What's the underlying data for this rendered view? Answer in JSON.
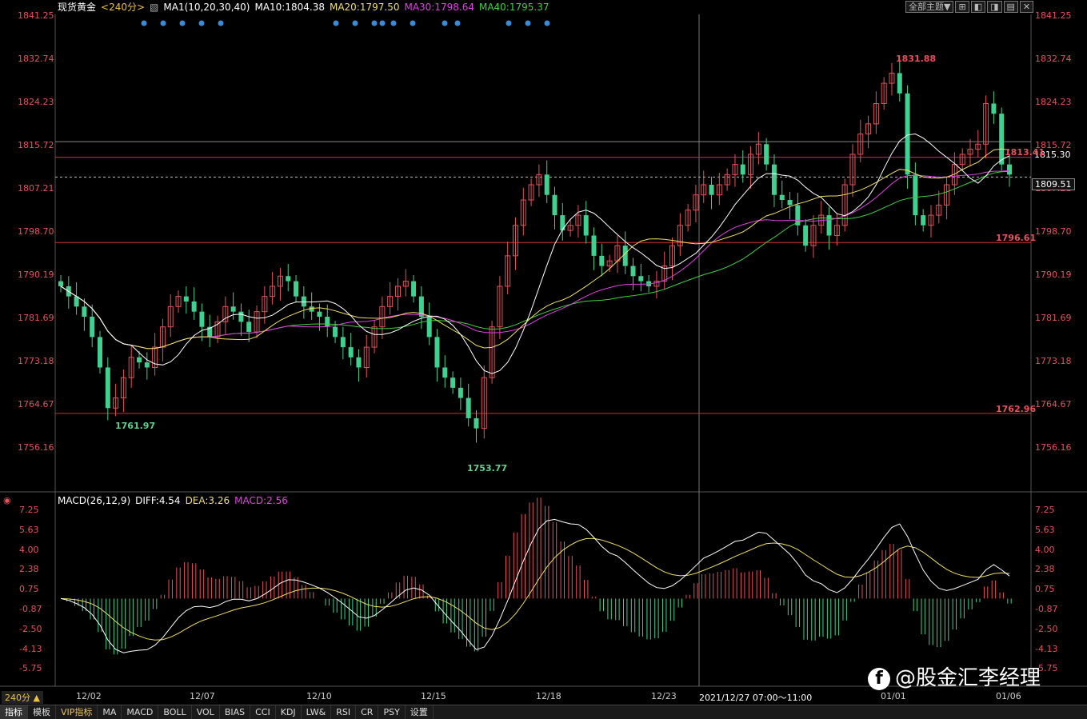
{
  "header": {
    "symbol": "现货黄金",
    "period": "<240分>",
    "ma_label": "MA1(10,20,30,40)",
    "ma10": "MA10:1804.38",
    "ma20": "MA20:1797.50",
    "ma30": "MA30:1798.64",
    "ma40": "MA40:1795.37",
    "theme_button": "全部主题▼",
    "colors": {
      "ma10": "#ffffff",
      "ma20": "#f0e060",
      "ma30": "#e040e0",
      "ma40": "#40d040"
    }
  },
  "price_axis": [
    "1841.25",
    "1832.74",
    "1824.23",
    "1815.72",
    "1807.21",
    "1798.70",
    "1790.19",
    "1781.69",
    "1773.18",
    "1764.67",
    "1756.16"
  ],
  "price_boxes": {
    "current_white": "1815.30",
    "current_box": "1809.51",
    "red_right": "1813.41"
  },
  "annotations": {
    "high": "1831.88",
    "low1": "1761.97",
    "low2": "1753.77",
    "line1": "1796.61",
    "line2": "1762.96"
  },
  "macd": {
    "label": "MACD(26,12,9)",
    "diff": "DIFF:4.54",
    "dea": "DEA:3.26",
    "macd": "MACD:2.56",
    "axis": [
      "7.25",
      "5.63",
      "4.00",
      "2.38",
      "0.75",
      "-0.87",
      "-2.50",
      "-4.13",
      "-5.75"
    ]
  },
  "dates": [
    "12/02",
    "12/07",
    "12/10",
    "12/15",
    "12/18",
    "12/23",
    "2021/12/27 07:00～11:00",
    "01/01",
    "01/06"
  ],
  "period_indicator": "240分 ▲",
  "bottom_tabs": [
    "指标",
    "模板",
    "VIP指标",
    "MA",
    "MACD",
    "BOLL",
    "VOL",
    "BIAS",
    "CCI",
    "KDJ",
    "LW&",
    "RSI",
    "CR",
    "PSY",
    "设置"
  ],
  "watermark": "@股金汇李经理",
  "chart_data": {
    "type": "candlestick",
    "title": "现货黄金",
    "ylim": [
      1750,
      1842
    ],
    "close_series": [
      1788,
      1786,
      1784,
      1782,
      1778,
      1772,
      1764,
      1766,
      1770,
      1774,
      1773,
      1772,
      1776,
      1780,
      1784,
      1786,
      1785,
      1783,
      1780,
      1778,
      1781,
      1784,
      1783,
      1781,
      1779,
      1783,
      1786,
      1788,
      1790,
      1789,
      1786,
      1784,
      1783,
      1782,
      1780,
      1778,
      1776,
      1774,
      1772,
      1776,
      1780,
      1784,
      1786,
      1788,
      1789,
      1786,
      1782,
      1778,
      1772,
      1770,
      1768,
      1766,
      1762,
      1760,
      1770,
      1780,
      1788,
      1794,
      1800,
      1805,
      1808,
      1810,
      1806,
      1802,
      1799,
      1800,
      1802,
      1798,
      1794,
      1792,
      1793,
      1796,
      1792,
      1790,
      1789,
      1788,
      1789,
      1792,
      1796,
      1800,
      1803,
      1806,
      1808,
      1806,
      1808,
      1810,
      1812,
      1810,
      1814,
      1816,
      1812,
      1806,
      1805,
      1804,
      1800,
      1796,
      1800,
      1802,
      1798,
      1800,
      1808,
      1814,
      1818,
      1820,
      1824,
      1828,
      1830,
      1826,
      1810,
      1802,
      1800,
      1802,
      1804,
      1808,
      1812,
      1814,
      1815,
      1816,
      1824,
      1822,
      1812,
      1810
    ]
  }
}
